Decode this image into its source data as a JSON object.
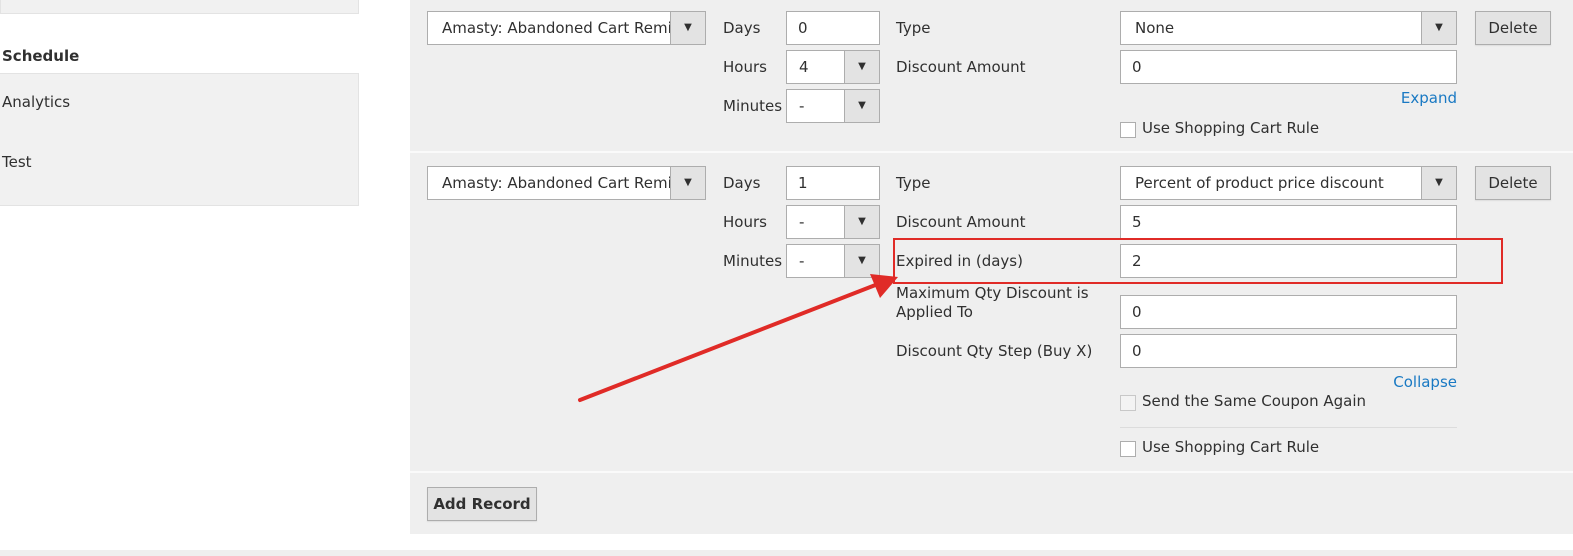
{
  "sidebar": {
    "items": [
      {
        "label": "Schedule"
      },
      {
        "label": "Analytics"
      },
      {
        "label": "Test"
      }
    ]
  },
  "labels": {
    "days": "Days",
    "hours": "Hours",
    "minutes": "Minutes",
    "type": "Type",
    "discount_amount": "Discount Amount",
    "expired_in_days": "Expired in (days)",
    "max_qty_discount": "Maximum Qty Discount is Applied To",
    "discount_qty_step": "Discount Qty Step (Buy X)"
  },
  "records": [
    {
      "template": "Amasty: Abandoned Cart Reminder",
      "days": "0",
      "hours": "4",
      "minutes": "-",
      "type": "None",
      "discount_amount": "0",
      "toggle_link": "Expand",
      "use_cart_rule": "Use Shopping Cart Rule",
      "delete_label": "Delete"
    },
    {
      "template": "Amasty: Abandoned Cart Reminder",
      "days": "1",
      "hours": "-",
      "minutes": "-",
      "type": "Percent of product price discount",
      "discount_amount": "5",
      "expired_in_days": "2",
      "max_qty_discount": "0",
      "discount_qty_step": "0",
      "toggle_link": "Collapse",
      "send_same_coupon": "Send the Same Coupon Again",
      "use_cart_rule": "Use Shopping Cart Rule",
      "delete_label": "Delete"
    }
  ],
  "add_record_label": "Add Record",
  "colors": {
    "annotation": "#e02b27",
    "link": "#1979c3",
    "panel_bg": "#efefef"
  },
  "icons": {
    "dropdown": "triangle-down"
  }
}
